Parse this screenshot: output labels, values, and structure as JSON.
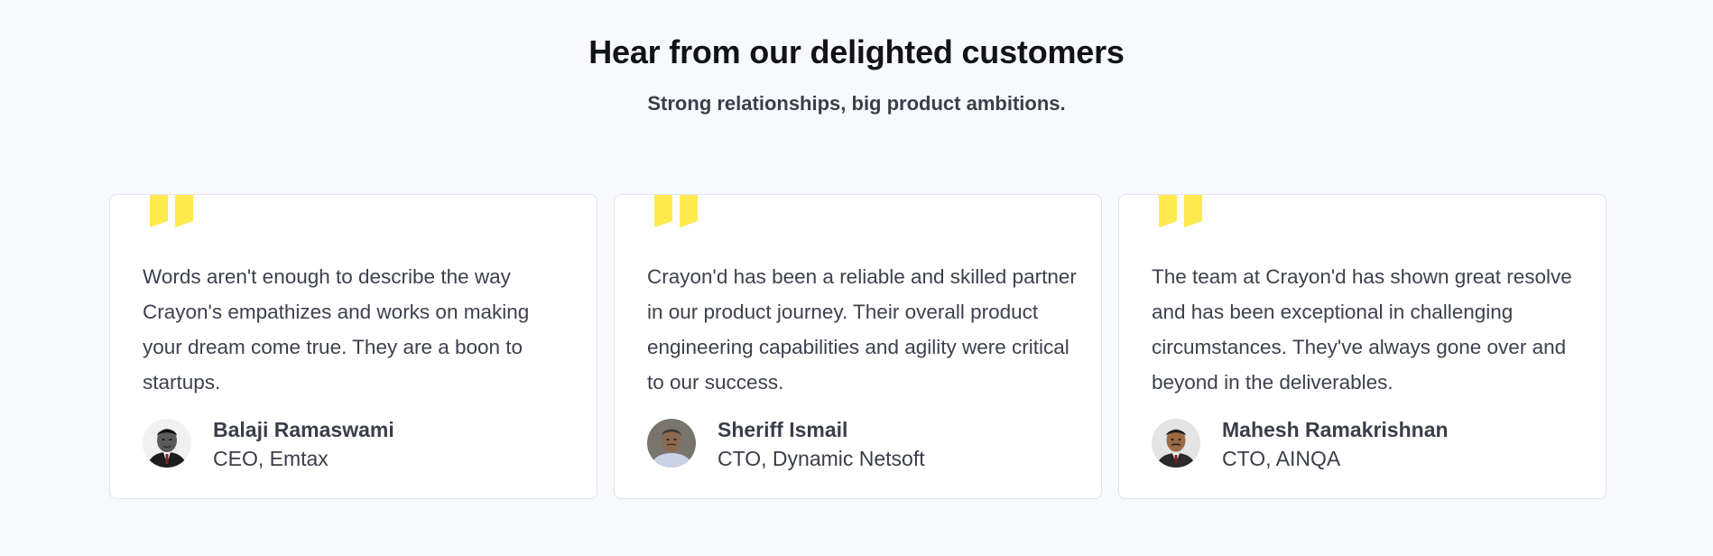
{
  "section": {
    "title": "Hear from our delighted customers",
    "subtitle": "Strong relationships, big product ambitions."
  },
  "colors": {
    "background": "#f8f9fc",
    "card": "#ffffff",
    "card_border": "#dde3ee",
    "quote_accent": "#ffe94d",
    "text_dark": "#111319",
    "text_body": "#3c414d"
  },
  "testimonials": [
    {
      "quote": "Words aren't enough to describe the way Crayon's empathizes and works on making your dream come true. They are a boon to startups.",
      "name": "Balaji Ramaswami",
      "role": "CEO, Emtax",
      "avatar_icon": "person-avatar"
    },
    {
      "quote": "Crayon'd has been a reliable and skilled partner in our product journey. Their overall product engineering capabilities and agility were critical to our success.",
      "name": "Sheriff Ismail",
      "role": "CTO, Dynamic Netsoft",
      "avatar_icon": "person-avatar"
    },
    {
      "quote": "The team at Crayon'd has shown great resolve and has been exceptional in challenging circumstances. They've always gone over and beyond in the deliverables.",
      "name": "Mahesh Ramakrishnan",
      "role": "CTO, AINQA",
      "avatar_icon": "person-avatar"
    }
  ]
}
